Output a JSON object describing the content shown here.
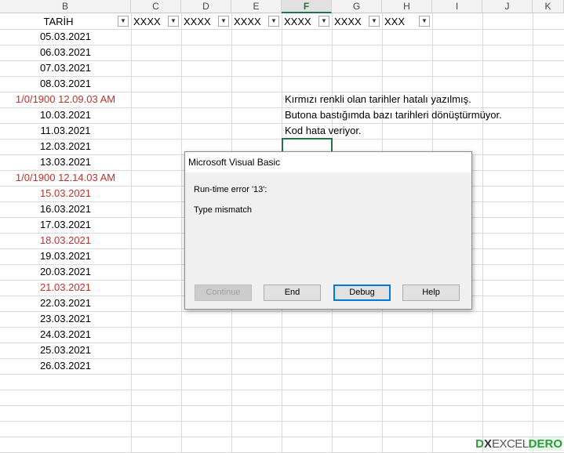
{
  "columns": [
    "B",
    "C",
    "D",
    "E",
    "F",
    "G",
    "H",
    "I",
    "J",
    "K"
  ],
  "selected_column": "F",
  "header_row": [
    "TARİH",
    "XXXX",
    "XXXX",
    "XXXX",
    "XXXX",
    "XXXX",
    "XXX"
  ],
  "dates": [
    {
      "text": "05.03.2021",
      "error": false
    },
    {
      "text": "06.03.2021",
      "error": false
    },
    {
      "text": "07.03.2021",
      "error": false
    },
    {
      "text": "08.03.2021",
      "error": false
    },
    {
      "text": "1/0/1900  12.09.03 AM",
      "error": true
    },
    {
      "text": "10.03.2021",
      "error": false
    },
    {
      "text": "11.03.2021",
      "error": false
    },
    {
      "text": "12.03.2021",
      "error": false
    },
    {
      "text": "13.03.2021",
      "error": false
    },
    {
      "text": "1/0/1900  12.14.03 AM",
      "error": true
    },
    {
      "text": "15.03.2021",
      "error": true
    },
    {
      "text": "16.03.2021",
      "error": false
    },
    {
      "text": "17.03.2021",
      "error": false
    },
    {
      "text": "18.03.2021",
      "error": true
    },
    {
      "text": "19.03.2021",
      "error": false
    },
    {
      "text": "20.03.2021",
      "error": false
    },
    {
      "text": "21.03.2021",
      "error": true
    },
    {
      "text": "22.03.2021",
      "error": false
    },
    {
      "text": "23.03.2021",
      "error": false
    },
    {
      "text": "24.03.2021",
      "error": false
    },
    {
      "text": "25.03.2021",
      "error": false
    },
    {
      "text": "26.03.2021",
      "error": false
    }
  ],
  "notes": [
    "Kırmızı renkli olan tarihler hatalı yazılmış.",
    "Butona bastığımda bazı tarihleri dönüştürmüyor.",
    "Kod hata veriyor."
  ],
  "dialog": {
    "title": "Microsoft Visual Basic",
    "message1": "Run-time error '13':",
    "message2": "Type mismatch",
    "buttons": {
      "continue": "Continue",
      "end": "End",
      "debug": "Debug",
      "help": "Help"
    }
  },
  "watermark": {
    "d": "D",
    "x": "X",
    "excel": "EXCEL",
    "dero": "DERO"
  },
  "colors": {
    "error_text": "#c0312b",
    "selection": "#217346"
  }
}
